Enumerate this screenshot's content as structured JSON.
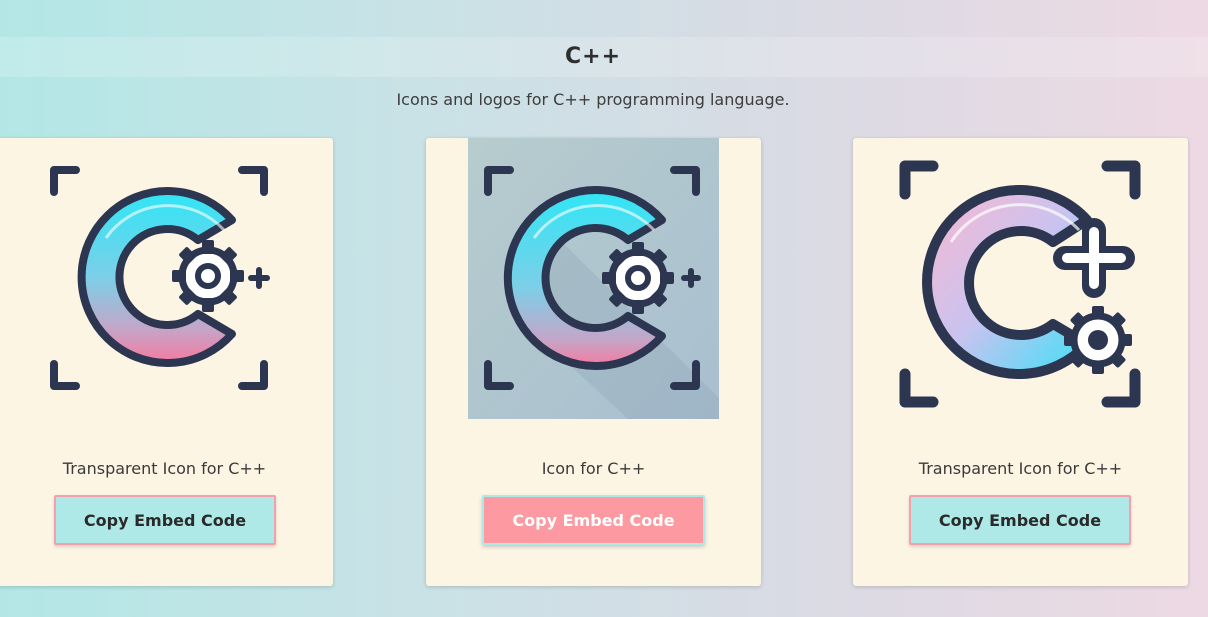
{
  "header": {
    "title": "C++",
    "subtitle": "Icons and logos for C++ programming language."
  },
  "cards": [
    {
      "title": "Transparent Icon for C++",
      "button_label": "Copy Embed Code",
      "image_icon": "cpp-gear-icon"
    },
    {
      "title": "Icon for C++",
      "button_label": "Copy Embed Code",
      "image_icon": "cpp-gear-icon"
    },
    {
      "title": "Transparent Icon for C++",
      "button_label": "Copy Embed Code",
      "image_icon": "cpp-plus-gear-icon"
    }
  ],
  "colors": {
    "button_default": "#aee9e7",
    "button_active": "#fd9aa1",
    "card_background": "#fdf5e4",
    "icon_outline": "#2d3650"
  }
}
